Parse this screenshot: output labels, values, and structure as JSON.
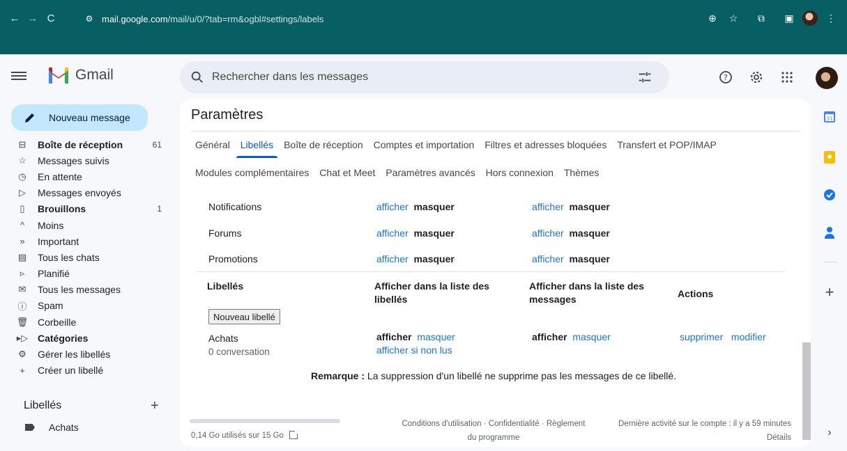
{
  "browser": {
    "url_host": "mail.google.com",
    "url_path": "/mail/u/0/?tab=rm&ogbl#settings/labels"
  },
  "app": {
    "name": "Gmail",
    "search_placeholder": "Rechercher dans les messages"
  },
  "sidebar": {
    "compose_label": "Nouveau message",
    "items": [
      {
        "label": "Boîte de réception",
        "count": "61",
        "icon": "inbox-icon",
        "bold": true
      },
      {
        "label": "Messages suivis",
        "count": "",
        "icon": "star-icon",
        "bold": false
      },
      {
        "label": "En attente",
        "count": "",
        "icon": "clock-icon",
        "bold": false
      },
      {
        "label": "Messages envoyés",
        "count": "",
        "icon": "send-icon",
        "bold": false
      },
      {
        "label": "Brouillons",
        "count": "1",
        "icon": "draft-icon",
        "bold": true
      },
      {
        "label": "Moins",
        "count": "",
        "icon": "chevron-up-icon",
        "bold": false
      },
      {
        "label": "Important",
        "count": "",
        "icon": "important-icon",
        "bold": false
      },
      {
        "label": "Tous les chats",
        "count": "",
        "icon": "chat-icon",
        "bold": false
      },
      {
        "label": "Planifié",
        "count": "",
        "icon": "scheduled-icon",
        "bold": false
      },
      {
        "label": "Tous les messages",
        "count": "",
        "icon": "all-mail-icon",
        "bold": false
      },
      {
        "label": "Spam",
        "count": "",
        "icon": "spam-icon",
        "bold": false
      },
      {
        "label": "Corbeille",
        "count": "",
        "icon": "trash-icon",
        "bold": false
      },
      {
        "label": "Catégories",
        "count": "",
        "icon": "label-outline-icon",
        "bold": true
      },
      {
        "label": "Gérer les libellés",
        "count": "",
        "icon": "gear-icon",
        "bold": false
      },
      {
        "label": "Créer un libellé",
        "count": "",
        "icon": "plus-icon",
        "bold": false
      }
    ],
    "labels_heading": "Libellés",
    "labels": [
      {
        "label": "Achats"
      }
    ]
  },
  "settings": {
    "title": "Paramètres",
    "tabs_row1": [
      "Général",
      "Libellés",
      "Boîte de réception",
      "Comptes et importation",
      "Filtres et adresses bloquées",
      "Transfert et POP/IMAP"
    ],
    "tabs_row2": [
      "Modules complémentaires",
      "Chat et Meet",
      "Paramètres avancés",
      "Hors connexion",
      "Thèmes"
    ],
    "active_tab": "Libellés",
    "system_rows": [
      {
        "name": "Notifications",
        "show": "afficher",
        "hide": "masquer"
      },
      {
        "name": "Forums",
        "show": "afficher",
        "hide": "masquer"
      },
      {
        "name": "Promotions",
        "show": "afficher",
        "hide": "masquer"
      }
    ],
    "labels_table": {
      "col_labels": "Libellés",
      "col_show_in_label_list": "Afficher dans la liste des libellés",
      "col_show_in_message_list": "Afficher dans la liste des messages",
      "col_actions": "Actions",
      "new_label_button": "Nouveau libellé",
      "rows": [
        {
          "name": "Achats",
          "count": "0 conversation",
          "list_show": "afficher",
          "list_hide": "masquer",
          "list_show_unread": "afficher si non lus",
          "msg_show": "afficher",
          "msg_hide": "masquer",
          "delete": "supprimer",
          "edit": "modifier"
        }
      ]
    },
    "remark_bold": "Remarque :",
    "remark_text": " La suppression d'un libellé ne supprime pas les messages de ce libellé."
  },
  "footer": {
    "storage": "0,14 Go utilisés sur 15 Go",
    "links_line1": "Conditions d'utilisation · Confidentialité · Règlement",
    "links_line2": "du programme",
    "last_activity": "Dernière activité sur le compte : il y a 59 minutes",
    "details": "Détails"
  },
  "colors": {
    "accent": "#0b57d0",
    "link": "#1a73e8",
    "compose_bg": "#c2e7ff",
    "chrome_bg": "#075e63"
  }
}
